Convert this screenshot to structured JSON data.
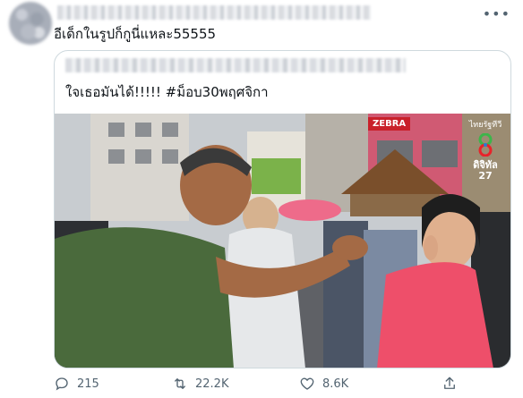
{
  "tweet": {
    "text": "อีเด็กในรูปก็กูนี่แหละ55555",
    "more_icon": "more-horizontal-icon"
  },
  "quote": {
    "text_main": "ใจเธอมันได้!!!!! ",
    "hashtag": "#ม็อบ30พฤศจิกา",
    "media": {
      "store_sign": "ZEBRA",
      "channel_top": "ไทยรัฐทีวี",
      "channel_num": "ดิจิทัล 27",
      "logo_colors": [
        "#3cb54a",
        "#e8232a",
        "#2a7bd3",
        "#f7b500"
      ]
    }
  },
  "actions": {
    "replies": "215",
    "retweets": "22.2K",
    "likes": "8.6K",
    "icons": [
      "reply-icon",
      "retweet-icon",
      "like-icon",
      "share-icon"
    ]
  },
  "colors": {
    "text": "#0f1419",
    "secondary": "#536471",
    "border": "#cfd9de"
  }
}
